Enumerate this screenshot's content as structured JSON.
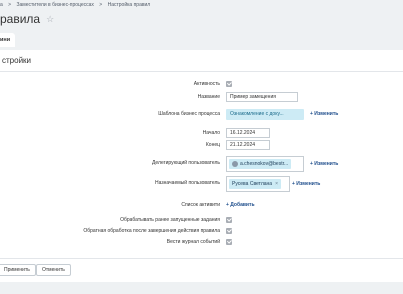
{
  "breadcrumbs": [
    "а",
    "Заместители в бизнес-процессах",
    "Настройка правил"
  ],
  "page": {
    "title": "равила"
  },
  "tab": {
    "label": "ини"
  },
  "section": {
    "title": "стройки"
  },
  "form": {
    "active_label": "Активность",
    "name_label": "Название",
    "name_value": "Пример замещения",
    "template_label": "Шаблона бизнес процесса",
    "template_value": "Ознакомление с доку...",
    "change_link": "+ Изменить",
    "start_label": "Начало",
    "start_value": "16.12.2024",
    "end_label": "Конец",
    "end_value": "21.12.2024",
    "delegating_label": "Делегирующий пользователь",
    "delegating_value": "a.chesnokov@bestr...",
    "assigned_label": "Назначаемый пользователь",
    "assigned_value": "Русева Светлана",
    "activities_label": "Список активити",
    "add_link": "+ Добавить",
    "process_started_label": "Обрабатывать ранее запущенные задания",
    "reverse_label": "Обратная обработка после завершения действия правила",
    "log_label": "Вести журнал событий"
  },
  "footer": {
    "apply_label": "Применить",
    "cancel_label": "Отменить"
  }
}
